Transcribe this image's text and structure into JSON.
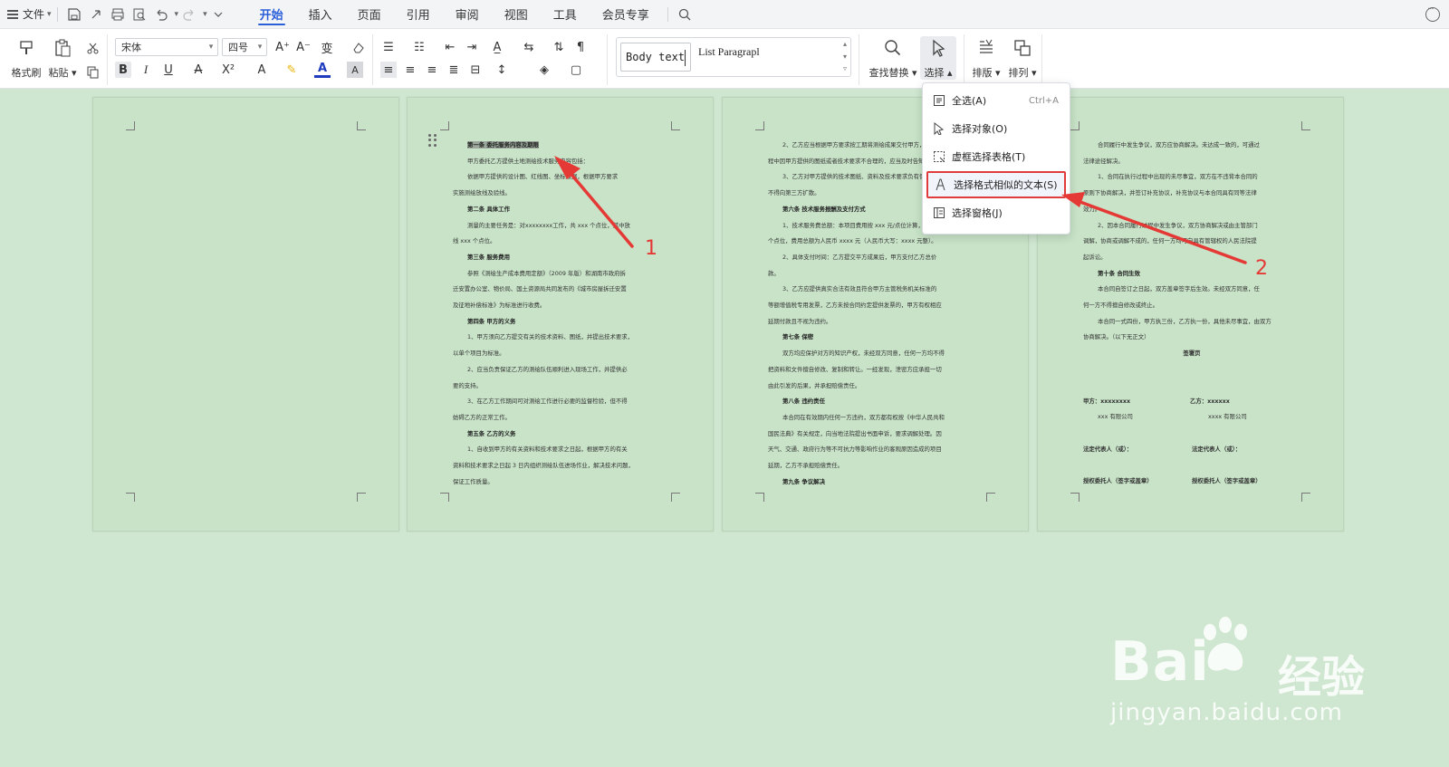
{
  "topbar": {
    "file_label": "文件",
    "tabs": [
      {
        "label": "开始",
        "active": true
      },
      {
        "label": "插入"
      },
      {
        "label": "页面"
      },
      {
        "label": "引用"
      },
      {
        "label": "审阅"
      },
      {
        "label": "视图"
      },
      {
        "label": "工具"
      },
      {
        "label": "会员专享"
      }
    ]
  },
  "ribbon": {
    "format_painter": "格式刷",
    "paste": "粘贴",
    "font_name": "宋体",
    "font_size": "四号",
    "style_1": "Body text",
    "style_2": "List Paragrapl",
    "find_replace": "查找替换",
    "select": "选择",
    "layout": "排版",
    "arrange": "排列"
  },
  "select_menu": {
    "items": [
      {
        "label": "全选(A)",
        "shortcut": "Ctrl+A",
        "icon": "select-all-icon"
      },
      {
        "label": "选择对象(O)",
        "icon": "cursor-arrow-icon"
      },
      {
        "label": "虚框选择表格(T)",
        "icon": "dashed-table-icon"
      },
      {
        "label": "选择格式相似的文本(S)",
        "icon": "text-a-cursor-icon",
        "highlighted": true
      },
      {
        "label": "选择窗格(J)",
        "icon": "selection-pane-icon"
      }
    ]
  },
  "pages": {
    "p2": [
      {
        "t": "第一条 委托服务内容及期限",
        "k": "hd hl"
      },
      {
        "t": "甲方委托乙方提供土地测绘技术服务内容包括：",
        "k": "ind"
      },
      {
        "t": "依据甲方提供的设计图、红线图、坐标数据，根据甲方要求",
        "k": "ind"
      },
      {
        "t": "实施测绘放线及验线。",
        "k": ""
      },
      {
        "t": "第二条 具体工作",
        "k": "hd"
      },
      {
        "t": "测量的主要任务是：对xxxxxxxx工作，共 xxx 个点位，其中放",
        "k": "ind"
      },
      {
        "t": "线 xxx 个点位。",
        "k": ""
      },
      {
        "t": "第三条 服务费用",
        "k": "hd"
      },
      {
        "t": "参照《测绘生产成本费用定额》（2009 年版）和湖南市政府拆",
        "k": "ind"
      },
      {
        "t": "迁安置办公室、物价局、国土资源局共同发布的《城市房屋拆迁安置",
        "k": ""
      },
      {
        "t": "及征地补偿标准》为标准进行收费。",
        "k": ""
      },
      {
        "t": "第四条 甲方的义务",
        "k": "hd"
      },
      {
        "t": "1、甲方须向乙方提交有关的技术资料、图纸，并提出技术要求，",
        "k": "ind"
      },
      {
        "t": "以单个项目为标准。",
        "k": ""
      },
      {
        "t": "2、应当负责保证乙方的测绘队伍顺利进入现场工作，并提供必",
        "k": "ind"
      },
      {
        "t": "要的支持。",
        "k": ""
      },
      {
        "t": "3、在乙方工作期间可对测绘工作进行必要的监督检验，但不得",
        "k": "ind"
      },
      {
        "t": "妨碍乙方的正常工作。",
        "k": ""
      },
      {
        "t": "第五条 乙方的义务",
        "k": "hd"
      },
      {
        "t": "1、自收到甲方的有关资料和技术要求之日起，根据甲方的有关",
        "k": "ind"
      },
      {
        "t": "资料和技术要求之日起 3 日内组织测绘队伍进场作业，解决技术问题，",
        "k": ""
      },
      {
        "t": "保证工作质量。",
        "k": ""
      }
    ],
    "p3": [
      {
        "t": "2、乙方应当根据甲方要求按工期将测绘成果交付甲方，如在工",
        "k": "ind"
      },
      {
        "t": "程中因甲方提供的图纸或者技术要求不合理的，应当及时告知甲方。",
        "k": ""
      },
      {
        "t": "3、乙方对甲方提供的技术图纸、资料及技术要求负有保密义务，",
        "k": "ind"
      },
      {
        "t": "不得向第三方扩散。",
        "k": ""
      },
      {
        "t": "第六条 技术服务报酬及支付方式",
        "k": "hd"
      },
      {
        "t": "1、技术服务费总额：本项目费用按 xxx 元/点位计算，共 xxx",
        "k": "ind"
      },
      {
        "t": "个点位，费用总额为人民币 xxxx 元（人民币大写：xxxx 元整）。",
        "k": ""
      },
      {
        "t": "2、具体支付时间：乙方提交平方成果后，甲方支付乙方总价",
        "k": "ind"
      },
      {
        "t": "款。",
        "k": ""
      },
      {
        "t": "3、乙方应提供真实合法有效且符合甲方主管税务机关标准的",
        "k": "ind"
      },
      {
        "t": "等额增值税专用发票，乙方未按合同约定提供发票的，甲方有权相应",
        "k": ""
      },
      {
        "t": "延期付款且不视为违约。",
        "k": ""
      },
      {
        "t": "第七条 保密",
        "k": "hd"
      },
      {
        "t": "双方均应保护对方的知识产权，未经双方同意，任何一方均不得",
        "k": "ind"
      },
      {
        "t": "把资料和文件擅自修改、复制和转让。一经发现，泄密方应承担一切",
        "k": ""
      },
      {
        "t": "由此引发的后果，并承担赔偿责任。",
        "k": ""
      },
      {
        "t": "第八条 违约责任",
        "k": "hd"
      },
      {
        "t": "本合同在有效期内任何一方违约，双方都有权按《中华人民共和",
        "k": "ind"
      },
      {
        "t": "国民法典》有关规定，向当地法院提出书面申诉，要求调解处理。因",
        "k": ""
      },
      {
        "t": "天气、交通、政府行为等不可抗力等影响作业的客观原因造成的项目",
        "k": ""
      },
      {
        "t": "延期，乙方不承担赔偿责任。",
        "k": ""
      },
      {
        "t": "第九条 争议解决",
        "k": "hd"
      }
    ],
    "p4": [
      {
        "t": "合同履行中发生争议，双方应协商解决。未达成一致的，可通过",
        "k": "ind"
      },
      {
        "t": "法律途径解决。",
        "k": ""
      },
      {
        "t": "1、合同在执行过程中出现的未尽事宜，双方在不违背本合同的",
        "k": "ind"
      },
      {
        "t": "原则下协商解决，并签订补充协议，补充协议与本合同具有同等法律",
        "k": ""
      },
      {
        "t": "效力。",
        "k": ""
      },
      {
        "t": "2、因本合同履行过程中发生争议，双方协商解决或由主管部门",
        "k": "ind"
      },
      {
        "t": "调解，协商或调解不成的，任何一方均可向具有管辖权的人民法院提",
        "k": ""
      },
      {
        "t": "起诉讼。",
        "k": ""
      },
      {
        "t": "第十条 合同生效",
        "k": "hd"
      },
      {
        "t": "本合同自签订之日起，双方盖章签字后生效。未经双方同意，任",
        "k": "ind"
      },
      {
        "t": "何一方不得擅自修改或终止。",
        "k": ""
      },
      {
        "t": "本合同一式四份，甲方执三份，乙方执一份，具他未尽事宜，由双方",
        "k": "ind"
      },
      {
        "t": "协商解决。（以下无正文）",
        "k": ""
      },
      {
        "t": "签署页",
        "k": "ctr"
      }
    ],
    "p4_sign": {
      "party_a": "甲方：xxxxxxxx",
      "party_b": "乙方：xxxxxx",
      "company_a": "xxx 有限公司",
      "company_b": "xxxx 有限公司",
      "legal_a": "法定代表人（或）：",
      "legal_b": "法定代表人（或）：",
      "agent_a": "授权委托人（签字或盖章）",
      "agent_b": "授权委托人（签字或盖章）"
    }
  },
  "annotations": {
    "label_1": "1",
    "label_2": "2"
  },
  "watermark": {
    "brand": "Bai",
    "brand_suffix": "经验",
    "url": "jingyan.baidu.com"
  },
  "colors": {
    "accent": "#2b5fd9",
    "annotation": "#e53935",
    "page": "#c8e3c8",
    "desktop": "#cfe6d0"
  }
}
